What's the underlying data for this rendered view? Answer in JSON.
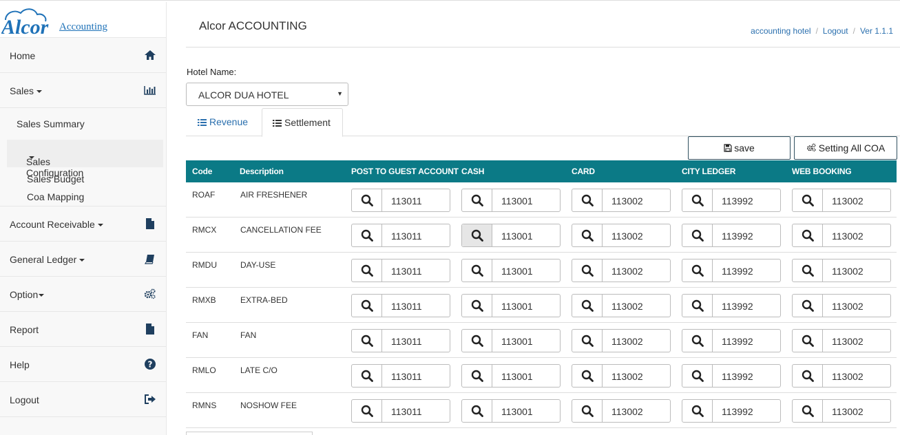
{
  "brand": {
    "logo_text": "Alcor",
    "logo_sub": "Accounting"
  },
  "sidebar": {
    "home": "Home",
    "sales": "Sales",
    "sales_summary": "Sales Summary",
    "sales_configuration": "Sales Configuration",
    "sales_budget": "Sales Budget",
    "coa_mapping": "Coa Mapping",
    "account_receivable": "Account Receivable",
    "general_ledger": "General Ledger",
    "option": "Option",
    "report": "Report",
    "help": "Help",
    "logout": "Logout"
  },
  "header": {
    "title": "Alcor ACCOUNTING",
    "crumb_user": "accounting hotel",
    "crumb_logout": "Logout",
    "crumb_version": "Ver 1.1.1"
  },
  "form": {
    "hotel_label": "Hotel Name:",
    "hotel_value": "ALCOR DUA HOTEL"
  },
  "tabs": {
    "revenue": "Revenue",
    "settlement": "Settlement"
  },
  "buttons": {
    "save": "save",
    "setting_all_coa": "Setting All COA"
  },
  "table": {
    "columns": [
      "Code",
      "Description",
      "POST TO GUEST ACCOUNT",
      "CASH",
      "CARD",
      "CITY LEDGER",
      "WEB BOOKING"
    ],
    "rows": [
      {
        "code": "ROAF",
        "desc": "AIR FRESHENER",
        "post": "113011",
        "cash": "113001",
        "card": "113002",
        "city": "113992",
        "web": "113002"
      },
      {
        "code": "RMCX",
        "desc": "CANCELLATION FEE",
        "post": "113011",
        "cash": "113001",
        "card": "113002",
        "city": "113992",
        "web": "113002"
      },
      {
        "code": "RMDU",
        "desc": "DAY-USE",
        "post": "113011",
        "cash": "113001",
        "card": "113002",
        "city": "113992",
        "web": "113002"
      },
      {
        "code": "RMXB",
        "desc": "EXTRA-BED",
        "post": "113011",
        "cash": "113001",
        "card": "113002",
        "city": "113992",
        "web": "113002"
      },
      {
        "code": "FAN",
        "desc": "FAN",
        "post": "113011",
        "cash": "113001",
        "card": "113002",
        "city": "113992",
        "web": "113002"
      },
      {
        "code": "RMLO",
        "desc": "LATE C/O",
        "post": "113011",
        "cash": "113001",
        "card": "113002",
        "city": "113992",
        "web": "113002"
      },
      {
        "code": "RMNS",
        "desc": "NOSHOW FEE",
        "post": "113011",
        "cash": "113001",
        "card": "113002",
        "city": "113992",
        "web": "113002"
      }
    ]
  },
  "colors": {
    "table_header": "#0b7a86",
    "link": "#2a6fae",
    "nav_icon": "#1f3f5f"
  }
}
